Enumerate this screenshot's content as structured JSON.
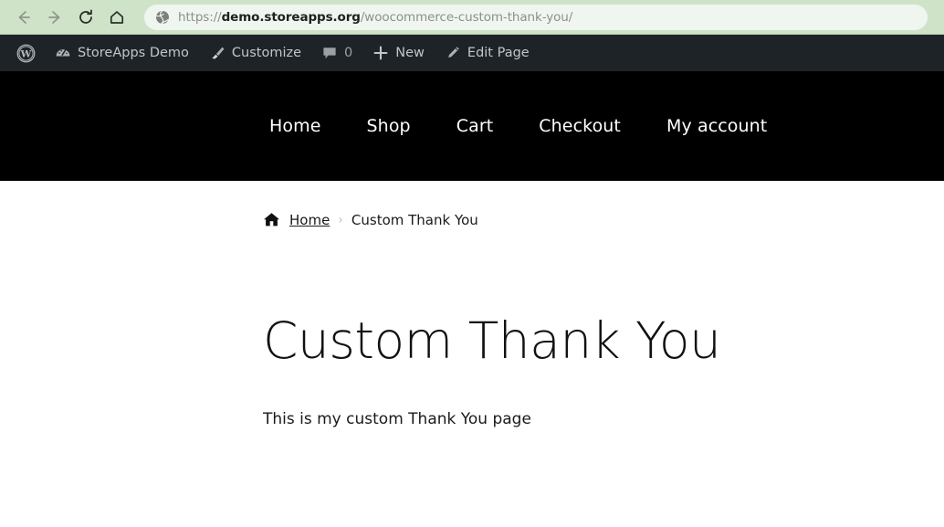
{
  "browser": {
    "back_label": "Back",
    "forward_label": "Forward",
    "reload_label": "Reload",
    "home_label": "Home",
    "url_full": "https://demo.storeapps.org/woocommerce-custom-thank-you/",
    "url_scheme": "https://",
    "url_host": "demo.storeapps.org",
    "url_path": "/woocommerce-custom-thank-you/",
    "site_icon": "globe-icon",
    "toolbar_color": "#cfe3c8",
    "url_field_color": "#eff6ef"
  },
  "admin_bar": {
    "background": "#1e2327",
    "text_color": "#c3c6c8",
    "logo": "wordpress-logo-icon",
    "items": [
      {
        "icon": "dashboard-icon",
        "label": "StoreApps Demo"
      },
      {
        "icon": "paintbrush-icon",
        "label": "Customize"
      },
      {
        "icon": "comment-bubble-icon",
        "label": "0"
      },
      {
        "icon": "plus-icon",
        "label": "New"
      },
      {
        "icon": "pencil-icon",
        "label": "Edit Page"
      }
    ]
  },
  "site_header": {
    "background": "#000000",
    "nav": [
      {
        "label": "Home"
      },
      {
        "label": "Shop"
      },
      {
        "label": "Cart"
      },
      {
        "label": "Checkout"
      },
      {
        "label": "My account"
      }
    ]
  },
  "breadcrumb": {
    "home_icon": "house-icon",
    "home_label": "Home",
    "separator": "›",
    "current": "Custom Thank You"
  },
  "page": {
    "title": "Custom Thank You",
    "body": "This is my custom Thank You page"
  }
}
